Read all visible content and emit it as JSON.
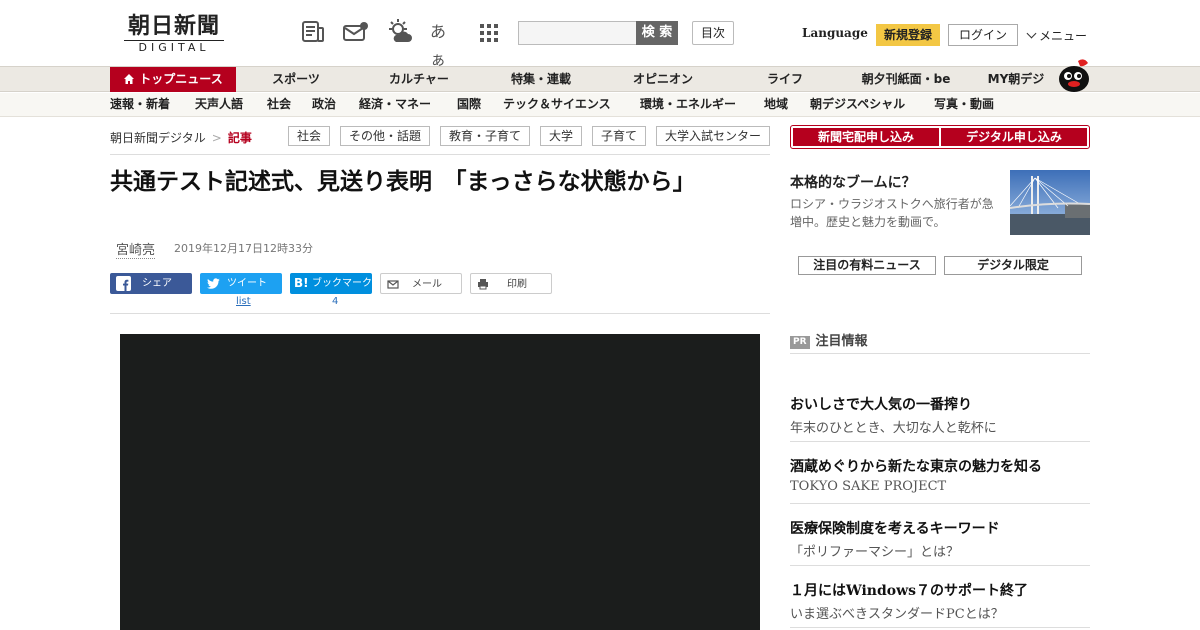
{
  "header": {
    "logo_jp": "朝日新聞",
    "logo_en": "DIGITAL",
    "icons": [
      "newspaper-icon",
      "mail-icon",
      "weather-icon",
      "font-size-icon",
      "apps-grid-icon"
    ],
    "font_size_label": "あぁ",
    "search_placeholder": "",
    "search_button": "検 索",
    "toc_button": "目次",
    "language": "Language",
    "register": "新規登録",
    "login": "ログイン",
    "menu": "メニュー"
  },
  "nav": {
    "items": [
      "トップニュース",
      "スポーツ",
      "カルチャー",
      "特集・連載",
      "オピニオン",
      "ライフ",
      "朝夕刊紙面・be",
      "MY朝デジ"
    ],
    "sub_items": [
      "速報・新着",
      "天声人語",
      "社会",
      "政治",
      "経済・マネー",
      "国際",
      "テック＆サイエンス",
      "環境・エネルギー",
      "地域",
      "朝デジスペシャル",
      "写真・動画"
    ]
  },
  "breadcrumb": {
    "home": "朝日新聞デジタル",
    "separator": ">",
    "current": "記事"
  },
  "tags": [
    "社会",
    "その他・話題",
    "教育・子育て",
    "大学",
    "子育て",
    "大学入試センター"
  ],
  "article": {
    "title": "共通テスト記述式、見送り表明　「まっさらな状態から」",
    "author": "宮崎亮",
    "date": "2019年12月17日12時33分"
  },
  "share": {
    "facebook": "シェア",
    "twitter": "ツイート",
    "hatena": "ブックマーク",
    "mail": "メール",
    "print": "印刷",
    "twitter_count": "list",
    "hatena_count": "4"
  },
  "sidebar": {
    "subscribe_paper": "新聞宅配申し込み",
    "subscribe_digital": "デジタル申し込み",
    "feature": {
      "title": "本格的なブームに？",
      "desc": "ロシア・ウラジオストクへ旅行者が急増中。歴史と魅力を動画で。"
    },
    "tabs": [
      "注目の有料ニュース",
      "デジタル限定"
    ],
    "pr_badge": "PR",
    "pr_header": "注目情報",
    "pr_items": [
      {
        "title": "おいしさで大人気の一番搾り",
        "sub": "年末のひととき、大切な人と乾杯に"
      },
      {
        "title": "酒蔵めぐりから新たな東京の魅力を知る",
        "sub": "TOKYO SAKE PROJECT"
      },
      {
        "title": "医療保険制度を考えるキーワード",
        "sub": "「ポリファーマシー」とは？"
      },
      {
        "title": "１月にはWindows７のサポート終了",
        "sub": "いま選ぶべきスタンダードPCとは？"
      }
    ]
  },
  "colors": {
    "brand_red": "#b5001e",
    "register_yellow": "#f3c744",
    "facebook": "#3b5998",
    "twitter": "#1da1f2",
    "hatena": "#008fde"
  }
}
